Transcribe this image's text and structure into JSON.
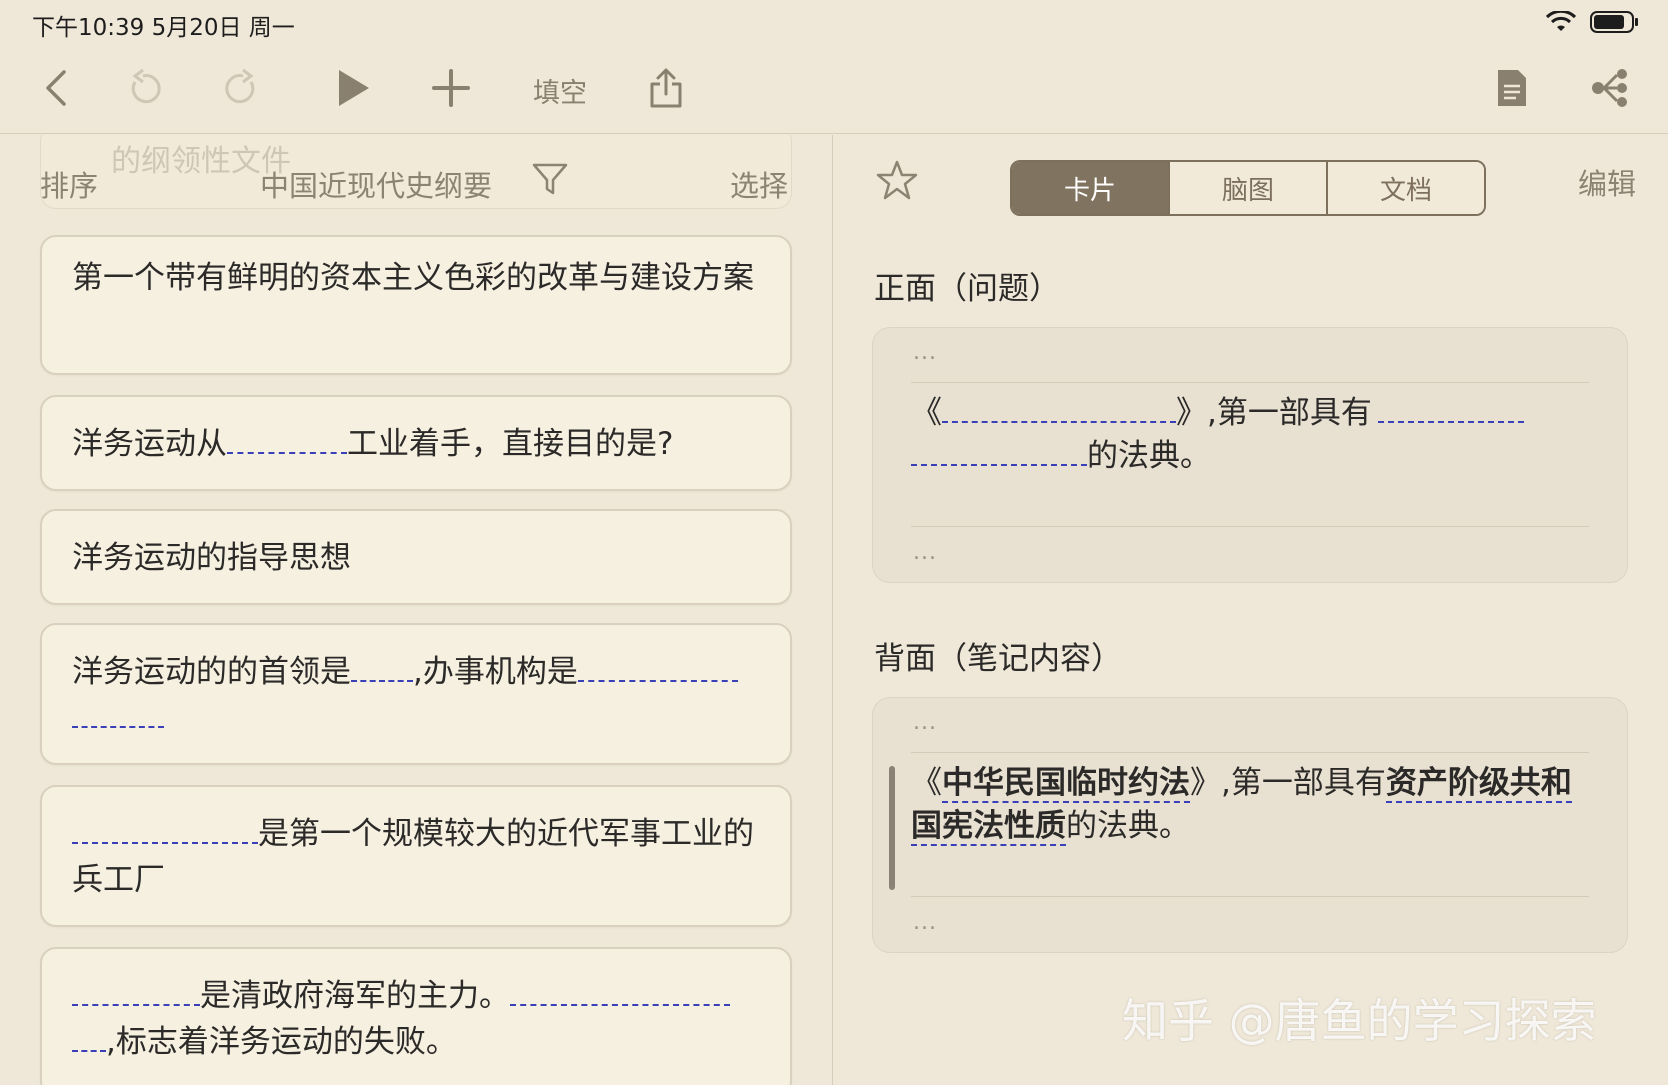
{
  "status": {
    "time": "下午10:39   5月20日 周一"
  },
  "toolbar": {
    "fill_blank_label": "填空"
  },
  "list": {
    "ghost_text": "的纲领性文件",
    "sort_label": "排序",
    "deck_title": "中国近现代史纲要",
    "select_label": "选择",
    "cards": [
      {
        "text": "第一个带有鲜明的资本主义色彩的改革与建设方案"
      },
      {
        "before": "洋务运动从",
        "after": "工业着手，直接目的是?"
      },
      {
        "text": "洋务运动的指导思想"
      },
      {
        "before": "洋务运动的的首领是",
        "mid": ",办事机构是"
      },
      {
        "after": "是第一个规模较大的近代军事工业的兵工厂"
      },
      {
        "after": "是清政府海军的主力。",
        "tail": ",标志着洋务运动的失败。"
      }
    ]
  },
  "detail": {
    "tabs": [
      "卡片",
      "脑图",
      "文档"
    ],
    "active_tab": "卡片",
    "edit_label": "编辑",
    "front_title": "正面（问题）",
    "back_title": "背面（笔记内容）",
    "dots": "...",
    "front": {
      "open": "《",
      "close": "》",
      "mid": ",第一部具有",
      "end": "的法典。"
    },
    "back": {
      "open": "《",
      "law": "中华民国临时约法",
      "close": "》",
      "mid": ",第一部具有",
      "nature": "资产阶级共和国宪法性质",
      "end": "的法典。"
    }
  },
  "watermark": "知乎 @唐鱼的学习探索"
}
